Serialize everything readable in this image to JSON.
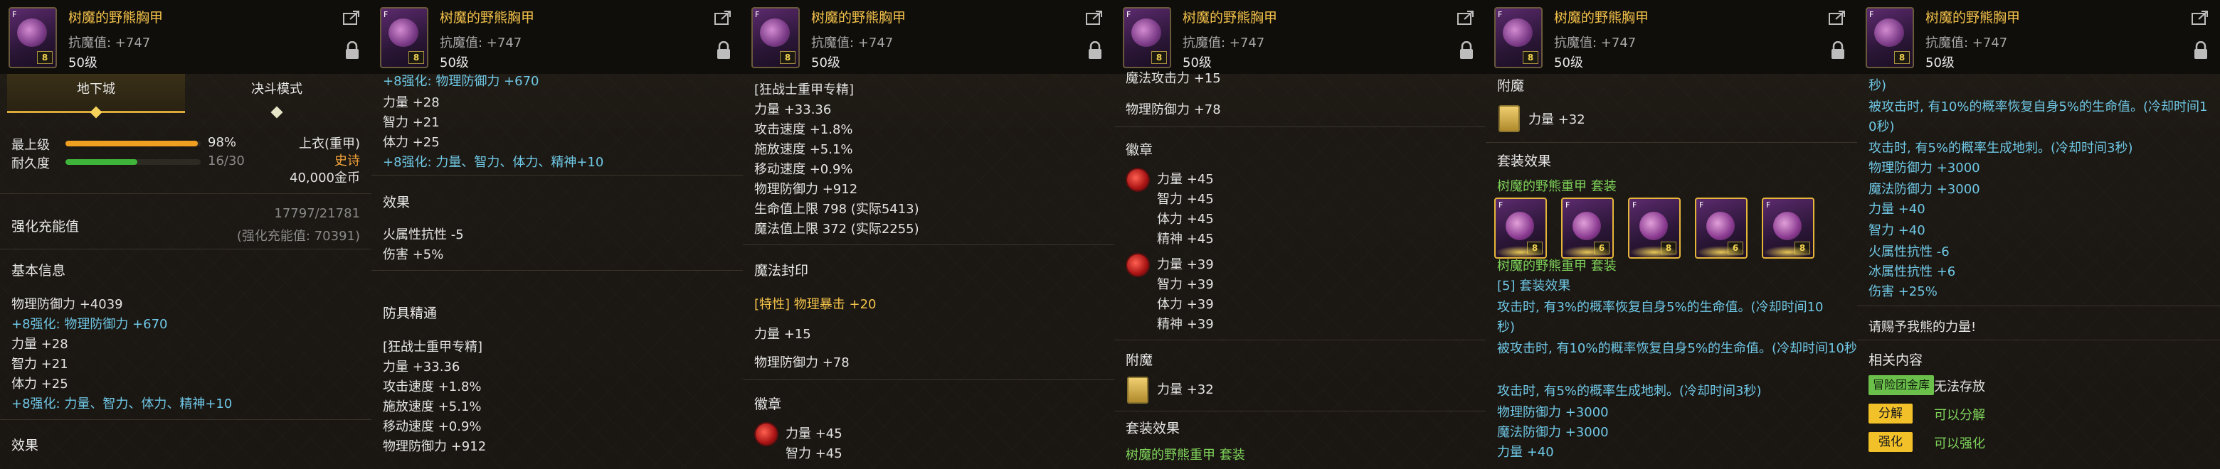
{
  "item": {
    "name": "树魔的野熊胸甲",
    "resist": "抗魔值: +747",
    "level": "50级",
    "icon_tag": "8",
    "icon_letter": "F"
  },
  "p1": {
    "tabs": [
      "地下城",
      "决斗模式"
    ],
    "upgrade_label": "最上级",
    "upgrade_pct": "98%",
    "upgrade_fraction": 0.98,
    "durability_label": "耐久度",
    "durability_value": "16/30",
    "durability_fraction": 0.533,
    "slot": "上衣(重甲)",
    "rarity": "史诗",
    "price": "40,000金币",
    "enhance_title": "强化充能值",
    "enhance_value": "17797/21781",
    "enhance_sub": "(强化充能值: 70391)",
    "basic_title": "基本信息",
    "lines": [
      "物理防御力 +4039",
      "+8强化: 物理防御力 +670",
      "力量 +28",
      "智力 +21",
      "体力 +25",
      "+8强化: 力量、智力、体力、精神+10"
    ],
    "effect_title": "效果"
  },
  "p2": {
    "top_line": "+8强化: 物理防御力 +670",
    "lines": [
      "力量 +28",
      "智力 +21",
      "体力 +25",
      "+8强化: 力量、智力、体力、精神+10"
    ],
    "effect_title": "效果",
    "effect_lines": [
      "火属性抗性 -5",
      "伤害 +5%"
    ],
    "armor_title": "防具精通",
    "armor_lines": [
      "[狂战士重甲专精]",
      "力量 +33.36",
      "攻击速度 +1.8%",
      "施放速度 +5.1%",
      "移动速度 +0.9%",
      "物理防御力 +912"
    ]
  },
  "p3": {
    "lines": [
      "[狂战士重甲专精]",
      "力量 +33.36",
      "攻击速度 +1.8%",
      "施放速度 +5.1%",
      "移动速度 +0.9%",
      "物理防御力 +912",
      "生命值上限 798 (实际5413)",
      "魔法值上限 372 (实际2255)"
    ],
    "magic_title": "魔法封印",
    "magic_lines": [
      "[特性] 物理暴击 +20",
      "力量 +15",
      "物理防御力 +78"
    ],
    "emblem_title": "徽章",
    "emblem_lines": [
      "力量 +45",
      "智力 +45"
    ]
  },
  "p4": {
    "top_line": "魔法攻击力 +15",
    "line_def": "物理防御力 +78",
    "emblem_title": "徽章",
    "emblem_a": [
      "力量 +45",
      "智力 +45",
      "体力 +45",
      "精神 +45"
    ],
    "emblem_b": [
      "力量 +39",
      "智力 +39",
      "体力 +39",
      "精神 +39"
    ],
    "enchant_title": "附魔",
    "enchant_line": "力量 +32",
    "set_title": "套装效果",
    "set_name": "树魔的野熊重甲 套装"
  },
  "p5": {
    "enchant_title": "附魔",
    "enchant_line": "力量 +32",
    "set_title": "套装效果",
    "set_name": "树魔的野熊重甲 套装",
    "set_icon_tags": [
      "8",
      "6",
      "8",
      "6",
      "8"
    ],
    "set_sub": "树魔的野熊重甲 套装",
    "set_count": "[5] 套装效果",
    "set_lines": [
      "攻击时, 有3%的概率恢复自身5%的生命值。(冷却时间10",
      "秒)",
      "被攻击时, 有10%的概率恢复自身5%的生命值。(冷却时间10秒)",
      "攻击时, 有5%的概率生成地刺。(冷却时间3秒)",
      "物理防御力 +3000",
      "魔法防御力 +3000",
      "力量 +40"
    ]
  },
  "p6": {
    "lines": [
      "秒)",
      "被攻击时, 有10%的概率恢复自身5%的生命值。(冷却时间1",
      "0秒)",
      "攻击时, 有5%的概率生成地刺。(冷却时间3秒)",
      "物理防御力 +3000",
      "魔法防御力 +3000",
      "力量 +40",
      "智力 +40",
      "火属性抗性 -6",
      "冰属性抗性 +6",
      "伤害 +25%"
    ],
    "quote": "请赐予我熊的力量!",
    "related_title": "相关内容",
    "guild_badge": "冒险团金库",
    "guild_text": "无法存放",
    "btn_disassemble": "分解",
    "btn_disassemble_note": "可以分解",
    "btn_enhance": "强化",
    "btn_enhance_note": "可以强化"
  },
  "colors": {
    "gold": "#f3c24a",
    "cyan": "#6fc8e6",
    "green": "#7ed35a",
    "orange_bar": "#f0a020"
  }
}
